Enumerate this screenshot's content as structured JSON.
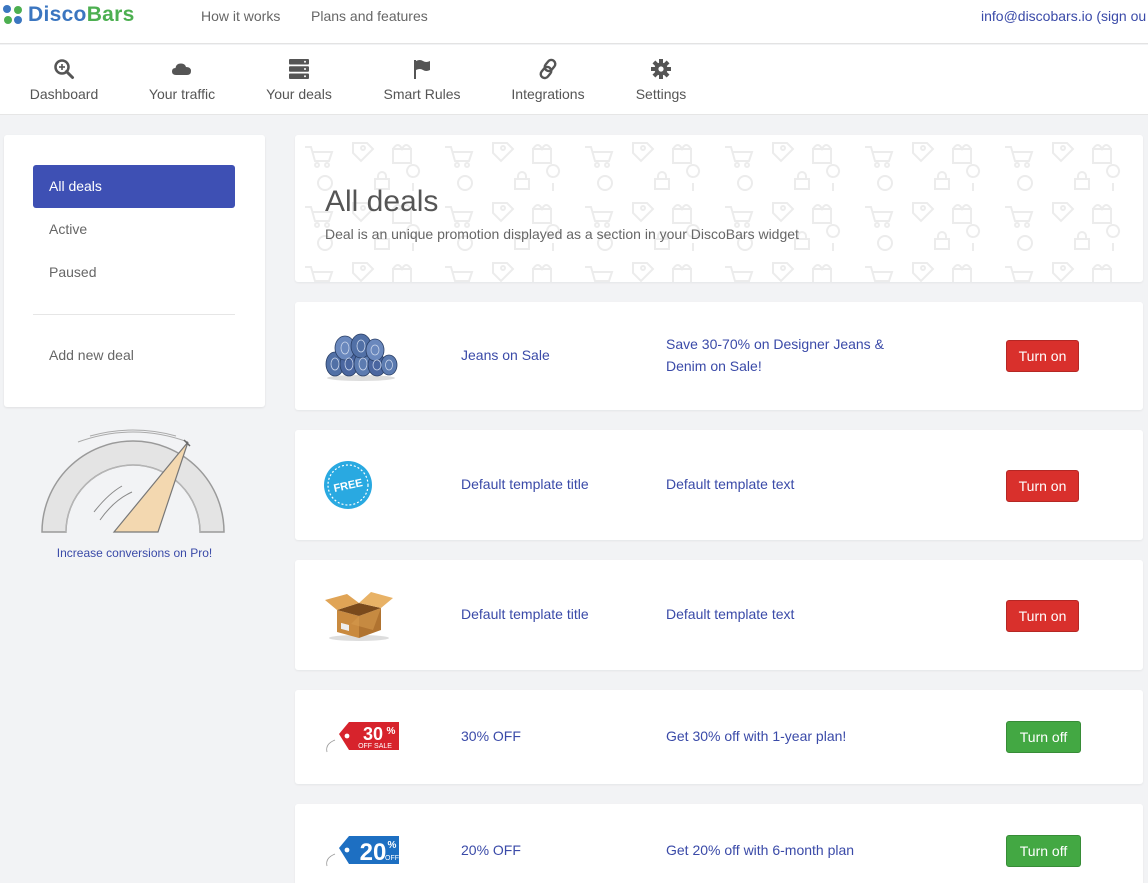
{
  "brand": {
    "name_part1": "Disco",
    "name_part2": "Bars"
  },
  "top_links": [
    {
      "label": "How it works"
    },
    {
      "label": "Plans and features"
    }
  ],
  "account": {
    "text": "info@discobars.io (sign ou"
  },
  "nav": [
    {
      "label": "Dashboard",
      "icon": "magnifier-icon"
    },
    {
      "label": "Your traffic",
      "icon": "cloud-icon"
    },
    {
      "label": "Your deals",
      "icon": "server-stack-icon"
    },
    {
      "label": "Smart Rules",
      "icon": "flag-icon"
    },
    {
      "label": "Integrations",
      "icon": "link-icon"
    },
    {
      "label": "Settings",
      "icon": "gear-icon"
    }
  ],
  "sidebar": {
    "items": [
      {
        "label": "All deals",
        "active": true
      },
      {
        "label": "Active",
        "active": false
      },
      {
        "label": "Paused",
        "active": false
      }
    ],
    "add_label": "Add new deal"
  },
  "promo": {
    "text": "Increase conversions on Pro!"
  },
  "header": {
    "title": "All deals",
    "subtitle": "Deal is an unique promotion displayed as a section in your DiscoBars widget"
  },
  "deals": [
    {
      "image": "jeans-image",
      "title": "Jeans on Sale",
      "text": "Save 30-70% on Designer Jeans & Denim on Sale!",
      "button": "Turn on",
      "state": "off"
    },
    {
      "image": "free-badge-image",
      "title": "Default template title",
      "text": "Default template text",
      "button": "Turn on",
      "state": "off"
    },
    {
      "image": "open-box-image",
      "title": "Default template title",
      "text": "Default template text",
      "button": "Turn on",
      "state": "off"
    },
    {
      "image": "sale-tag-30-image",
      "title": "30% OFF",
      "text": "Get 30% off with 1-year plan!",
      "button": "Turn off",
      "state": "on"
    },
    {
      "image": "sale-tag-20-image",
      "title": "20% OFF",
      "text": "Get 20% off with 6-month plan",
      "button": "Turn off",
      "state": "on"
    }
  ],
  "colors": {
    "brand_blue": "#3b76c0",
    "brand_green": "#4caf50",
    "active_nav": "#3e50b4",
    "link_text": "#3a4aa8",
    "turn_on": "#d9302c",
    "turn_off": "#43a843"
  },
  "badge_texts": {
    "free": "FREE",
    "tag30_big": "30",
    "tag30_small": "OFF SALE",
    "tag20_big": "20",
    "tag20_small": "OFF",
    "percent": "%"
  }
}
